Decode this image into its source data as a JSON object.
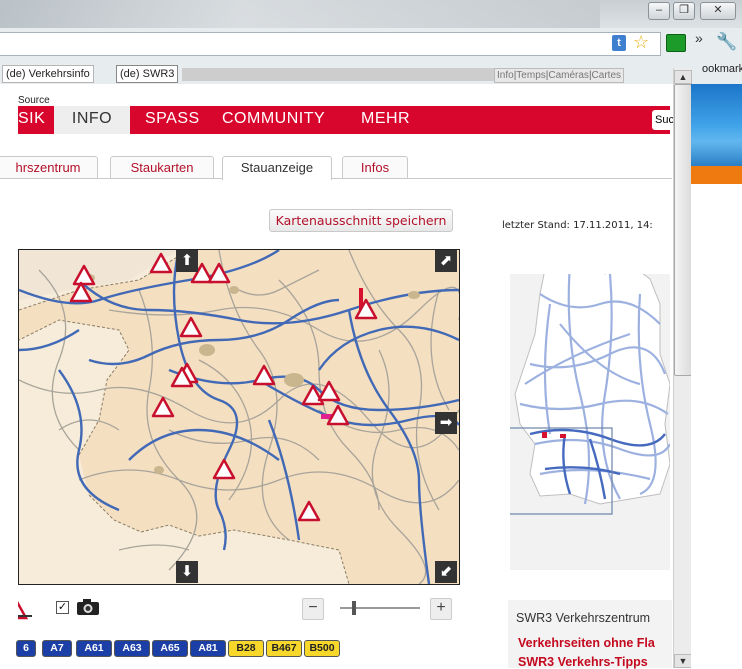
{
  "browser": {
    "tab1_label": "(de) Verkehrsinfo",
    "tab2_label": "(de) SWR3",
    "tab_links": [
      "Info",
      "Temps",
      "Caméras",
      "Cartes"
    ],
    "bookmarks_label": "ookmarks",
    "window_buttons": [
      "minimize-icon",
      "restore-icon",
      "close-icon"
    ],
    "toolbar_icons": [
      "translate-icon",
      "star-icon",
      "extension-icon",
      "overflow-icon",
      "wrench-icon"
    ],
    "colors": {
      "chrome": "#e7ecef",
      "nav_red": "#d8062c",
      "link_red": "#c4091f"
    }
  },
  "page": {
    "source_label": "Source",
    "nav": {
      "items": [
        "SIK",
        "INFO",
        "SPASS",
        "COMMUNITY",
        "MEHR"
      ],
      "active": "INFO",
      "search_text": "Suc"
    },
    "subtabs": {
      "items": [
        "hrszentrum",
        "Staukarten",
        "Stauanzeige",
        "Infos"
      ],
      "active": "Stauanzeige"
    },
    "save_button_label": "Kartenausschnitt speichern",
    "last_update_label": "letzter Stand: 17.11.2011, 14:",
    "map": {
      "pan_controls": [
        "up",
        "right",
        "down",
        "expand",
        "collapse"
      ],
      "checkbox_checked": true,
      "zoom_minus": "−",
      "zoom_plus": "+",
      "zoom_level": 0.18
    },
    "roads": [
      "6",
      "A7",
      "A61",
      "A63",
      "A65",
      "A81",
      "B28",
      "B467",
      "B500"
    ],
    "verkehrszentrum": {
      "title": "SWR3 Verkehrszentrum",
      "links": [
        "Verkehrseiten ohne Fla",
        "SWR3 Verkehrs-Tipps"
      ]
    }
  }
}
